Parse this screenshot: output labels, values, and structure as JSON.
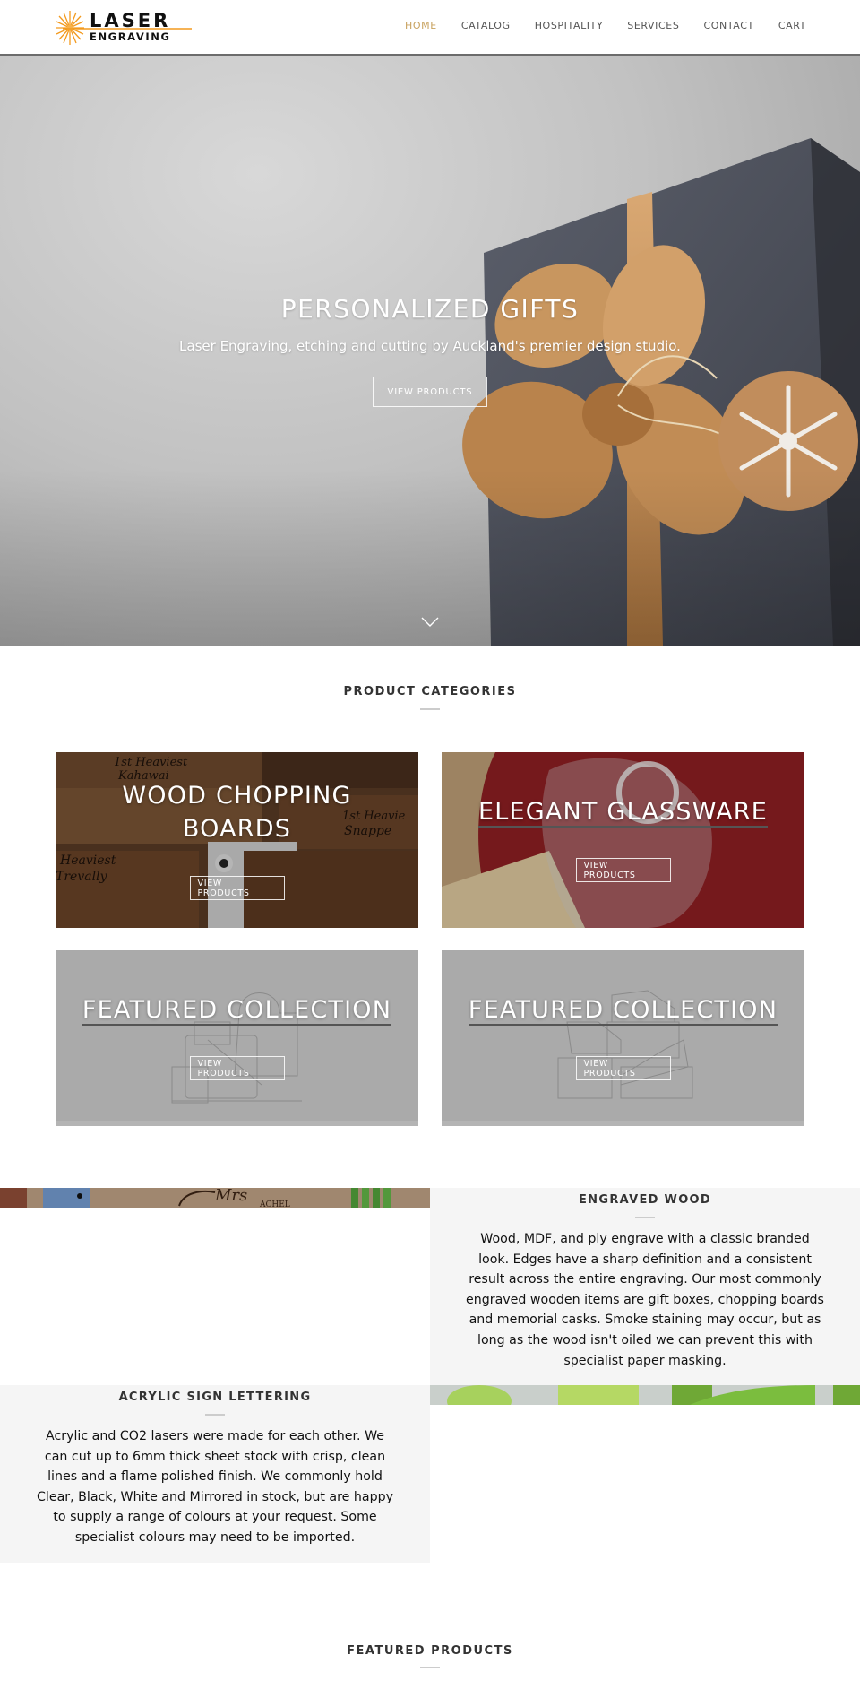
{
  "header": {
    "logo": {
      "line1": "LASER",
      "line2": "ENGRAVING",
      "accent_color": "#f39a1e"
    },
    "nav": [
      {
        "label": "HOME",
        "active": true
      },
      {
        "label": "CATALOG",
        "active": false
      },
      {
        "label": "HOSPITALITY",
        "active": false
      },
      {
        "label": "SERVICES",
        "active": false
      },
      {
        "label": "CONTACT",
        "active": false
      },
      {
        "label": "CART",
        "active": false
      }
    ],
    "active_color": "#c8a25f"
  },
  "hero": {
    "title": "PERSONALIZED GIFTS",
    "subtitle": "Laser Engraving, etching and cutting by Auckland's premier design studio.",
    "button_label": "VIEW PRODUCTS",
    "scroll_icon": "chevron-down-icon"
  },
  "product_categories": {
    "title": "PRODUCT CATEGORIES",
    "cards": [
      {
        "title_line1": "WOOD CHOPPING",
        "title_line2": "BOARDS",
        "button_label": "VIEW PRODUCTS",
        "image": "engraved wooden chopping boards"
      },
      {
        "title": "ELEGANT GLASSWARE",
        "button_label": "VIEW PRODUCTS",
        "image": "etched wine glass on red cloth"
      },
      {
        "title": "FEATURED COLLECTION",
        "button_label": "VIEW PRODUCTS",
        "image": "bags line illustration"
      },
      {
        "title": "FEATURED COLLECTION",
        "button_label": "VIEW PRODUCTS",
        "image": "shoes line illustration"
      }
    ]
  },
  "features": [
    {
      "heading": "ENGRAVED WOOD",
      "body": "Wood, MDF, and ply engrave with a classic branded look. Edges have a sharp definition and a consistent result across the entire engraving. Our most commonly engraved wooden items are gift boxes, chopping boards and memorial casks. Smoke staining may occur, but as long as the wood isn't oiled we can prevent this with specialist paper masking.",
      "image": "engraved wooden board with vegetables"
    },
    {
      "heading": "ACRYLIC SIGN LETTERING",
      "body": "Acrylic and CO2 lasers were made for each other. We can cut up to 6mm thick sheet stock with crisp, clean lines and a flame polished finish. We commonly hold Clear, Black, White and Mirrored in stock, but are happy to supply a range of colours at your request. Some specialist colours may need to be imported.",
      "image": "green acrylic letters"
    }
  ],
  "featured_products": {
    "title": "FEATURED PRODUCTS"
  }
}
